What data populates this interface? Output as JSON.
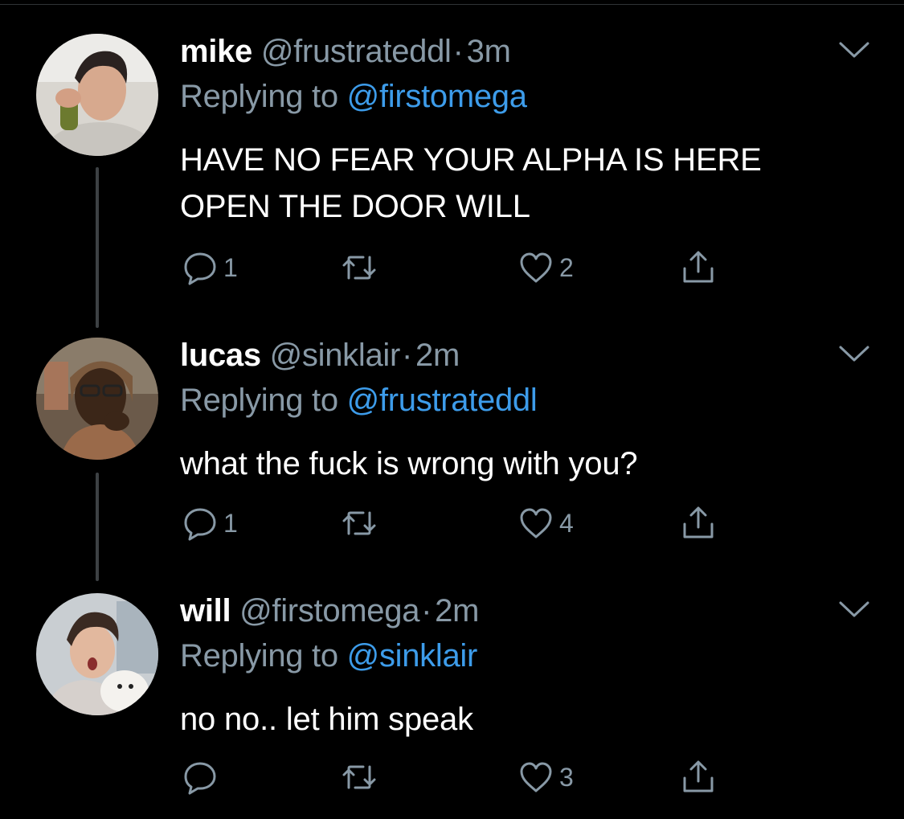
{
  "tweets": [
    {
      "name": "mike",
      "handle": "@frustrateddl",
      "separator": "·",
      "time": "3m",
      "replying_prefix": "Replying to ",
      "replying_to": "@firstomega",
      "text": "HAVE NO FEAR YOUR ALPHA IS HERE OPEN THE DOOR WILL",
      "replies": "1",
      "retweets": "",
      "likes": "2"
    },
    {
      "name": "lucas",
      "handle": "@sinklair",
      "separator": "·",
      "time": "2m",
      "replying_prefix": "Replying to ",
      "replying_to": "@frustrateddl",
      "text": "what the fuck is wrong with you?",
      "replies": "1",
      "retweets": "",
      "likes": "4"
    },
    {
      "name": "will",
      "handle": "@firstomega",
      "separator": "·",
      "time": "2m",
      "replying_prefix": "Replying to ",
      "replying_to": "@sinklair",
      "text": "no no.. let him speak",
      "replies": "",
      "retweets": "",
      "likes": "3"
    }
  ],
  "icons": {
    "reply": "reply-icon",
    "retweet": "retweet-icon",
    "like": "heart-icon",
    "share": "share-icon",
    "more": "chevron-down-icon"
  },
  "colors": {
    "background": "#000000",
    "text": "#ffffff",
    "secondary": "#8899a6",
    "mention": "#3d9cea",
    "thread_line": "#3d4144"
  }
}
